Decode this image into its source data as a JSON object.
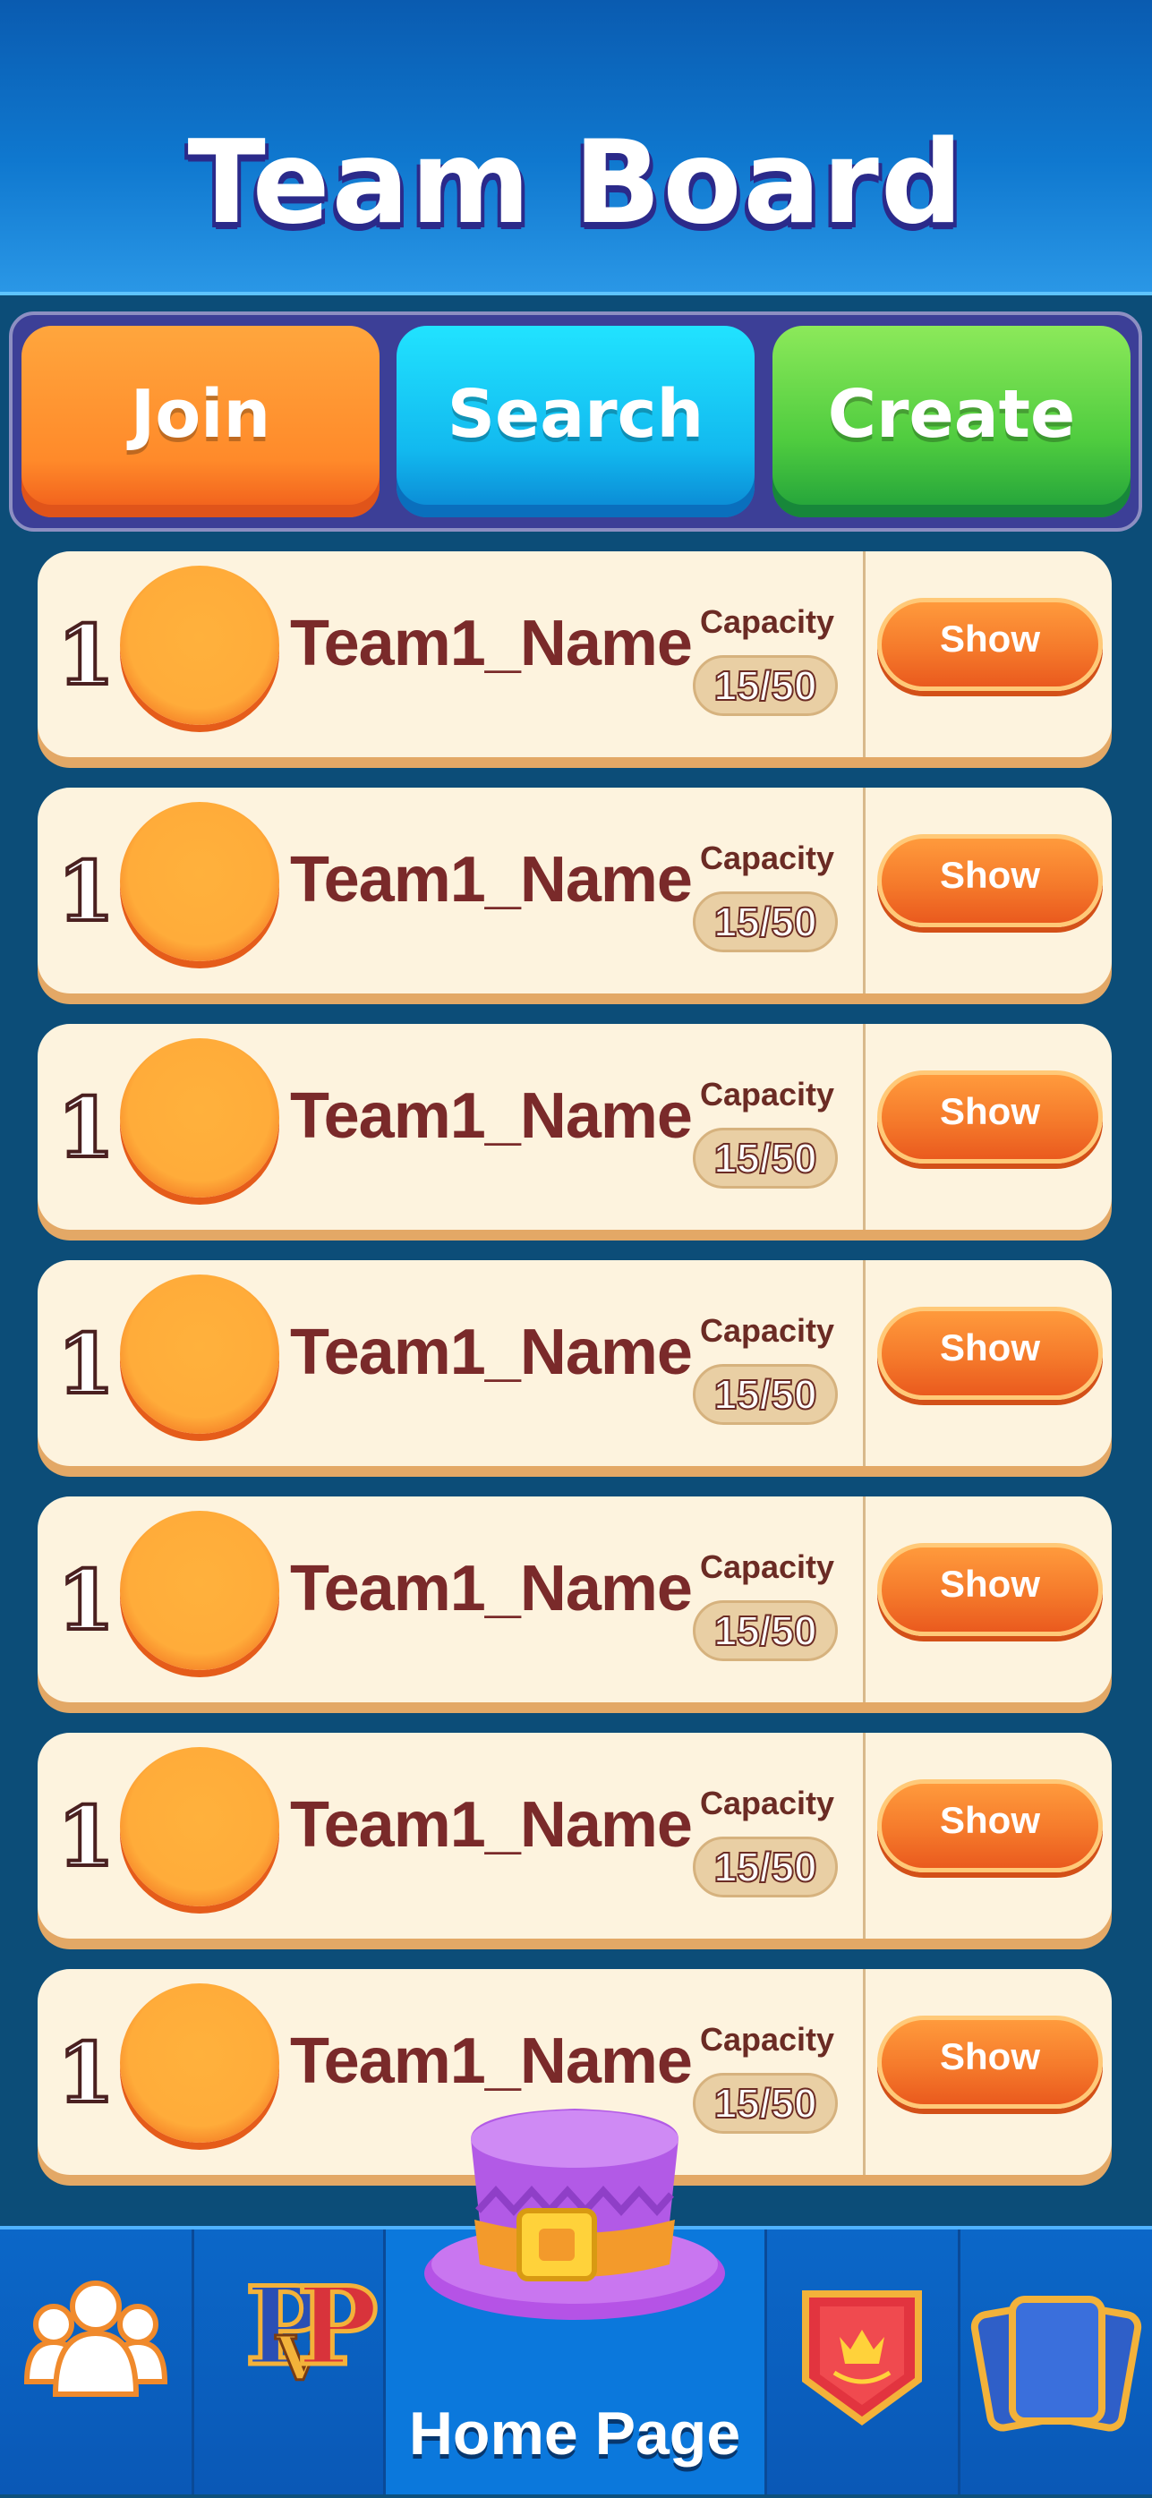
{
  "header": {
    "title": "Team Board"
  },
  "tabs": [
    {
      "id": "join",
      "label": "Join"
    },
    {
      "id": "search",
      "label": "Search"
    },
    {
      "id": "create",
      "label": "Create"
    }
  ],
  "teams": [
    {
      "rank": "1",
      "name": "Team1_Name",
      "capacity_label": "Capacity",
      "capacity": "15/50",
      "action": "Show"
    },
    {
      "rank": "1",
      "name": "Team1_Name",
      "capacity_label": "Capacity",
      "capacity": "15/50",
      "action": "Show"
    },
    {
      "rank": "1",
      "name": "Team1_Name",
      "capacity_label": "Capacity",
      "capacity": "15/50",
      "action": "Show"
    },
    {
      "rank": "1",
      "name": "Team1_Name",
      "capacity_label": "Capacity",
      "capacity": "15/50",
      "action": "Show"
    },
    {
      "rank": "1",
      "name": "Team1_Name",
      "capacity_label": "Capacity",
      "capacity": "15/50",
      "action": "Show"
    },
    {
      "rank": "1",
      "name": "Team1_Name",
      "capacity_label": "Capacity",
      "capacity": "15/50",
      "action": "Show"
    },
    {
      "rank": "1",
      "name": "Team1_Name",
      "capacity_label": "Capacity",
      "capacity": "15/50",
      "action": "Show"
    }
  ],
  "nav": {
    "items": [
      {
        "icon": "team-icon"
      },
      {
        "icon": "pvp-icon",
        "text": "PvP"
      },
      {
        "icon": "top-hat-icon",
        "label": "Home Page"
      },
      {
        "icon": "trophy-banner-icon"
      },
      {
        "icon": "cards-icon"
      }
    ]
  },
  "colors": {
    "header_blue": "#0f78cf",
    "list_bg": "#0c4d78",
    "row_bg": "#fdf3de",
    "team_name": "#7a2a2a",
    "join": "#ff8a2a",
    "search": "#12b9ef",
    "create": "#4fcc3f",
    "show_button": "#f57a2b"
  }
}
